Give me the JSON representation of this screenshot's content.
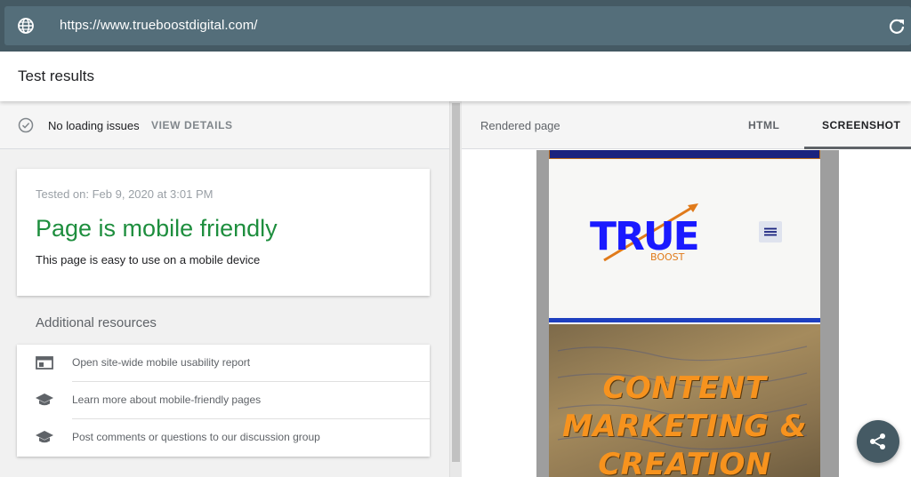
{
  "urlbar": {
    "url": "https://www.trueboostdigital.com/"
  },
  "header": {
    "title": "Test results"
  },
  "status": {
    "text": "No loading issues",
    "details_label": "VIEW DETAILS"
  },
  "result": {
    "tested_on": "Tested on: Feb 9, 2020 at 3:01 PM",
    "verdict": "Page is mobile friendly",
    "verdict_sub": "This page is easy to use on a mobile device"
  },
  "resources": {
    "title": "Additional resources",
    "items": [
      {
        "label": "Open site-wide mobile usability report",
        "icon": "web-layout-icon"
      },
      {
        "label": "Learn more about mobile-friendly pages",
        "icon": "graduation-cap-icon"
      },
      {
        "label": "Post comments or questions to our discussion group",
        "icon": "graduation-cap-icon"
      }
    ]
  },
  "preview": {
    "label": "Rendered page",
    "tabs": [
      {
        "label": "HTML"
      },
      {
        "label": "SCREENSHOT",
        "active": true
      }
    ],
    "site": {
      "logo_main": "TRUE",
      "logo_sub": "BOOST",
      "hero_lines": [
        "CONTENT",
        "MARKETING &",
        "CREATION"
      ]
    }
  },
  "colors": {
    "verdict_green": "#1e8e3e",
    "topbar": "#455a64",
    "hero_text": "#f7931e",
    "logo_blue": "#1a1aff"
  }
}
